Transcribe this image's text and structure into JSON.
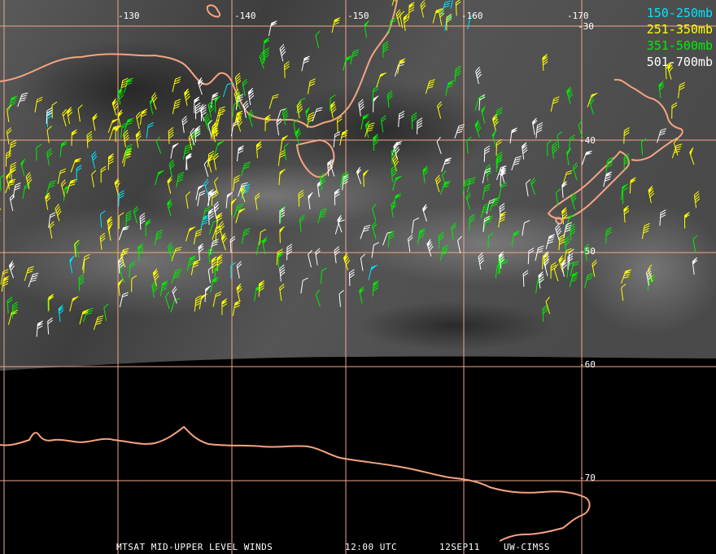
{
  "legend": [
    {
      "label": "150-250mb",
      "color": "#00e5ff"
    },
    {
      "label": "251-350mb",
      "color": "#ffff00"
    },
    {
      "label": "351-500mb",
      "color": "#00ee00"
    },
    {
      "label": "501-700mb",
      "color": "#ffffff"
    }
  ],
  "longitude_labels": [
    "-130",
    "-140",
    "-150",
    "-160",
    "-170"
  ],
  "latitude_labels": [
    "-30",
    "-40",
    "-50",
    "-60",
    "-70"
  ],
  "footer": {
    "product": "MTSAT MID-UPPER LEVEL WINDS",
    "time": "12:00 UTC",
    "date": "12SEP11",
    "source": "UW-CIMSS"
  },
  "colors": {
    "grid": "#f0a888",
    "coastline": "#f4a482",
    "background": "#000000"
  },
  "icons": [
    "wind-barb"
  ]
}
